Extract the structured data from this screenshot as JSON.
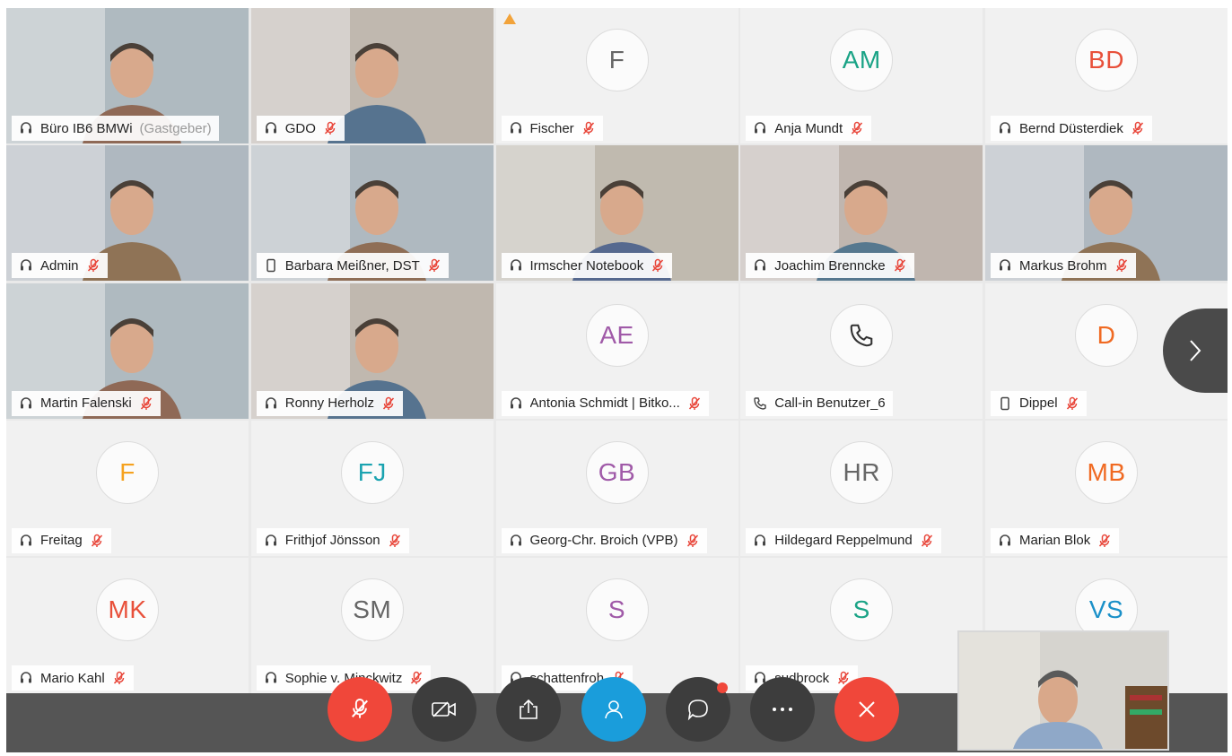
{
  "colors": {
    "accent_blue": "#1a9ddb",
    "mute_red": "#e8463a",
    "end_red": "#f0473a",
    "warning_orange": "#f2a33a"
  },
  "participants": [
    {
      "name": "Büro IB6 BMWi",
      "role": "(Gastgeber)",
      "video": true,
      "host": true,
      "muted": false,
      "device": "headset"
    },
    {
      "name": "GDO",
      "video": true,
      "muted": true,
      "device": "headset"
    },
    {
      "name": "Fischer",
      "initials": "F",
      "initials_color": "#666666",
      "muted": true,
      "device": "headset",
      "warning": true
    },
    {
      "name": "Anja Mundt",
      "initials": "AM",
      "initials_color": "#1aa386",
      "muted": true,
      "device": "headset"
    },
    {
      "name": "Bernd Düsterdiek",
      "initials": "BD",
      "initials_color": "#e8503a",
      "muted": true,
      "device": "headset"
    },
    {
      "name": "Admin",
      "video": true,
      "muted": true,
      "device": "headset"
    },
    {
      "name": "Barbara Meißner, DST",
      "video": true,
      "muted": true,
      "device": "mobile"
    },
    {
      "name": "Irmscher Notebook",
      "video": true,
      "muted": true,
      "device": "headset"
    },
    {
      "name": "Joachim Brenncke",
      "video": true,
      "muted": true,
      "device": "headset"
    },
    {
      "name": "Markus Brohm",
      "video": true,
      "muted": true,
      "device": "headset"
    },
    {
      "name": "Martin Falenski",
      "video": true,
      "muted": true,
      "device": "headset"
    },
    {
      "name": "Ronny Herholz",
      "video": true,
      "muted": true,
      "device": "headset"
    },
    {
      "name": "Antonia Schmidt | Bitko...",
      "initials": "AE",
      "initials_color": "#a05aa8",
      "muted": true,
      "device": "headset"
    },
    {
      "name": "Call-in Benutzer_6",
      "initials": "",
      "phone": true,
      "muted": false,
      "device": "phone"
    },
    {
      "name": "Dippel",
      "initials": "D",
      "initials_color": "#f06a22",
      "muted": true,
      "device": "mobile"
    },
    {
      "name": "Freitag",
      "initials": "F",
      "initials_color": "#f5a21f",
      "muted": true,
      "device": "headset"
    },
    {
      "name": "Frithjof Jönsson",
      "initials": "FJ",
      "initials_color": "#1aa3b0",
      "muted": true,
      "device": "headset"
    },
    {
      "name": "Georg-Chr. Broich (VPB)",
      "initials": "GB",
      "initials_color": "#a05aa8",
      "muted": true,
      "device": "headset"
    },
    {
      "name": "Hildegard Reppelmund",
      "initials": "HR",
      "initials_color": "#666666",
      "muted": true,
      "device": "headset"
    },
    {
      "name": "Marian Blok",
      "initials": "MB",
      "initials_color": "#f06a22",
      "muted": true,
      "device": "headset"
    },
    {
      "name": "Mario Kahl",
      "initials": "MK",
      "initials_color": "#e8503a",
      "muted": true,
      "device": "headset"
    },
    {
      "name": "Sophie v. Minckwitz",
      "initials": "SM",
      "initials_color": "#666666",
      "muted": true,
      "device": "headset"
    },
    {
      "name": "schattenfroh",
      "initials": "S",
      "initials_color": "#a05aa8",
      "muted": true,
      "device": "headset"
    },
    {
      "name": "sudbrock",
      "initials": "S",
      "initials_color": "#1aa386",
      "muted": true,
      "device": "headset"
    },
    {
      "name": "",
      "initials": "VS",
      "initials_color": "#1a90c8",
      "muted": false,
      "device": "none"
    }
  ],
  "toolbar": {
    "buttons": [
      {
        "name": "mute-button",
        "icon": "microphone-muted-icon",
        "style": "red"
      },
      {
        "name": "video-button",
        "icon": "video-off-icon",
        "style": "dark"
      },
      {
        "name": "share-button",
        "icon": "share-icon",
        "style": "dark"
      },
      {
        "name": "participants-button",
        "icon": "participants-icon",
        "style": "blue"
      },
      {
        "name": "chat-button",
        "icon": "chat-icon",
        "style": "dark",
        "notification": true
      },
      {
        "name": "more-button",
        "icon": "more-icon",
        "style": "dark"
      },
      {
        "name": "leave-button",
        "icon": "close-icon",
        "style": "red"
      }
    ]
  },
  "navigation": {
    "next_icon": "chevron-right-icon"
  }
}
